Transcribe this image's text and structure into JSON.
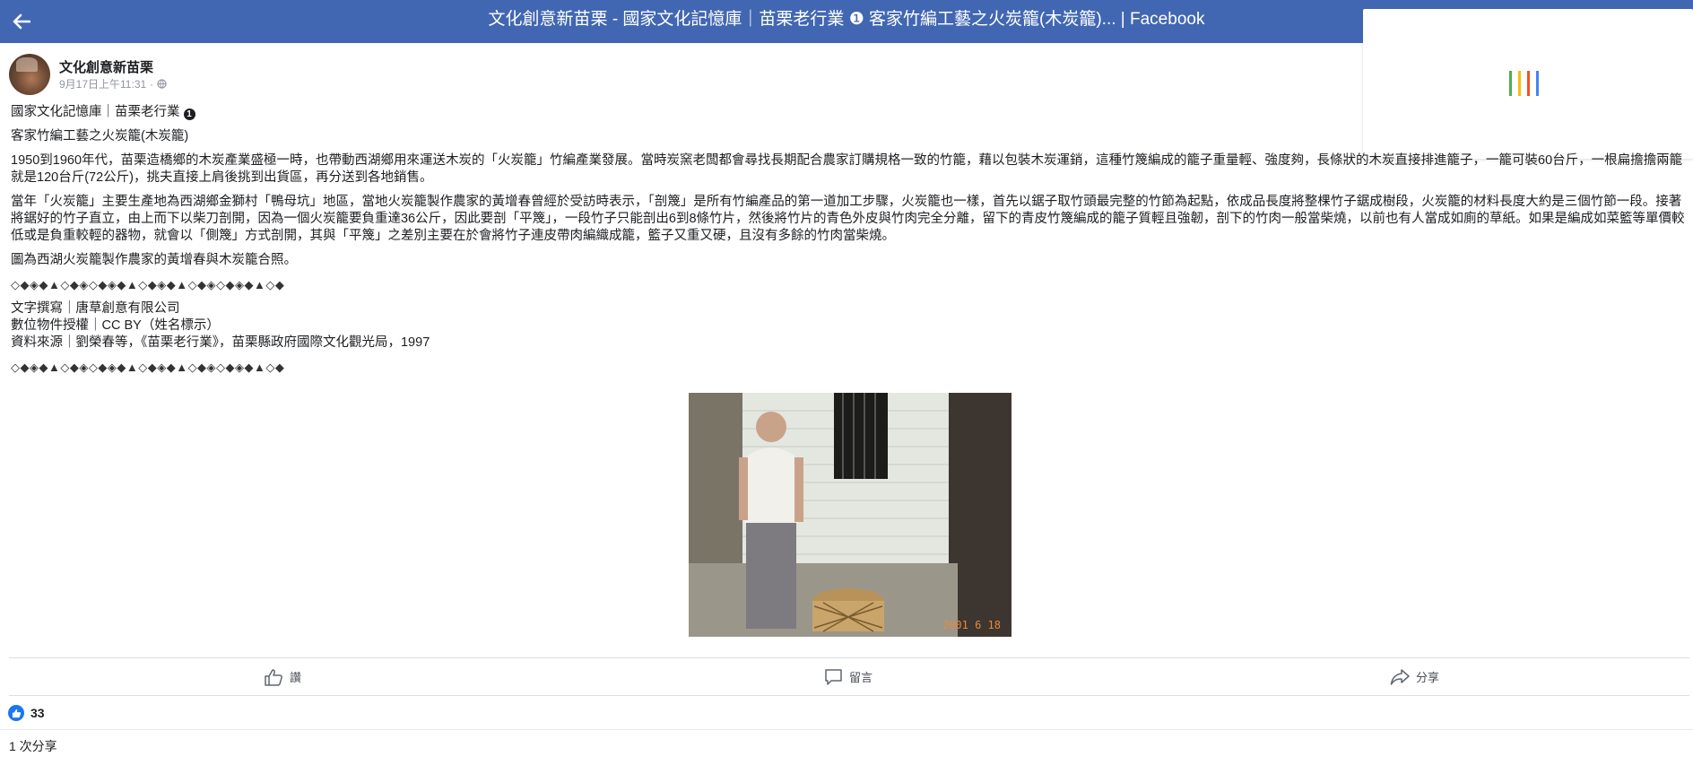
{
  "window": {
    "title": "文化創意新苗栗 - 國家文化記憶庫｜苗栗老行業 ❶ 客家竹編工藝之火炭籠(木炭籠)... | Facebook",
    "back_icon": "arrow-left-icon"
  },
  "loading_panel": {
    "bar_colors": [
      "#4caf50",
      "#fbbc05",
      "#f4511e",
      "#4285f4"
    ]
  },
  "post": {
    "page_name": "文化創意新苗栗",
    "timestamp": "9月17日上午11:31",
    "separator": "·",
    "privacy_icon": "globe-icon",
    "line_category": "國家文化記憶庫｜苗栗老行業",
    "line_title": "客家竹編工藝之火炭籠(木炭籠)",
    "para1": "1950到1960年代，苗栗造橋鄉的木炭產業盛極一時，也帶動西湖鄉用來運送木炭的「火炭籠」竹編產業發展。當時炭窯老闆都會尋找長期配合農家訂購規格一致的竹籠，藉以包裝木炭運銷，這種竹篾編成的籠子重量輕、強度夠，長條狀的木炭直接排進籠子，一籠可裝60台斤，一根扁擔擔兩籠就是120台斤(72公斤)，挑夫直接上肩後挑到出貨區，再分送到各地銷售。",
    "para2": "當年「火炭籠」主要生產地為西湖鄉金獅村「鴨母坑」地區，當地火炭籠製作農家的黃增春曾經於受訪時表示，「剖篾」是所有竹編產品的第一道加工步驟，火炭籠也一樣，首先以鋸子取竹頭最完整的竹節為起點，依成品長度將整棵竹子鋸成樹段，火炭籠的材料長度大約是三個竹節一段。接著將鋸好的竹子直立，由上而下以柴刀剖開，因為一個火炭籠要負重達36公斤，因此要剖「平篾」，一段竹子只能剖出6到8條竹片，然後將竹片的青色外皮與竹肉完全分離，留下的青皮竹篾編成的籠子質輕且強韌，剖下的竹肉一般當柴燒，以前也有人當成如廁的草紙。如果是編成如菜籃等單價較低或是負重較輕的器物，就會以「側篾」方式剖開，其與「平篾」之差別主要在於會將竹子連皮帶肉編織成籠，籃子又重又硬，且沒有多餘的竹肉當柴燒。",
    "caption": "圖為西湖火炭籠製作農家的黃增春與木炭籠合照。",
    "divider": "◇◆◈◆▲◇◆◈◇◆◈◆▲◇◆◈◆▲◇◆◈◇◆◈◆▲◇◆",
    "credit_author": "文字撰寫｜唐草創意有限公司",
    "credit_license": "數位物件授權｜CC BY（姓名標示）",
    "credit_source": "資料來源｜劉榮春等，《苗栗老行業》，苗栗縣政府國際文化觀光局，1997",
    "photo_date_stamp": "2001 6 18"
  },
  "actions": {
    "like_label": "讚",
    "comment_label": "留言",
    "share_label": "分享"
  },
  "stats": {
    "reaction_count": "33",
    "shares_text": "1 次分享"
  }
}
